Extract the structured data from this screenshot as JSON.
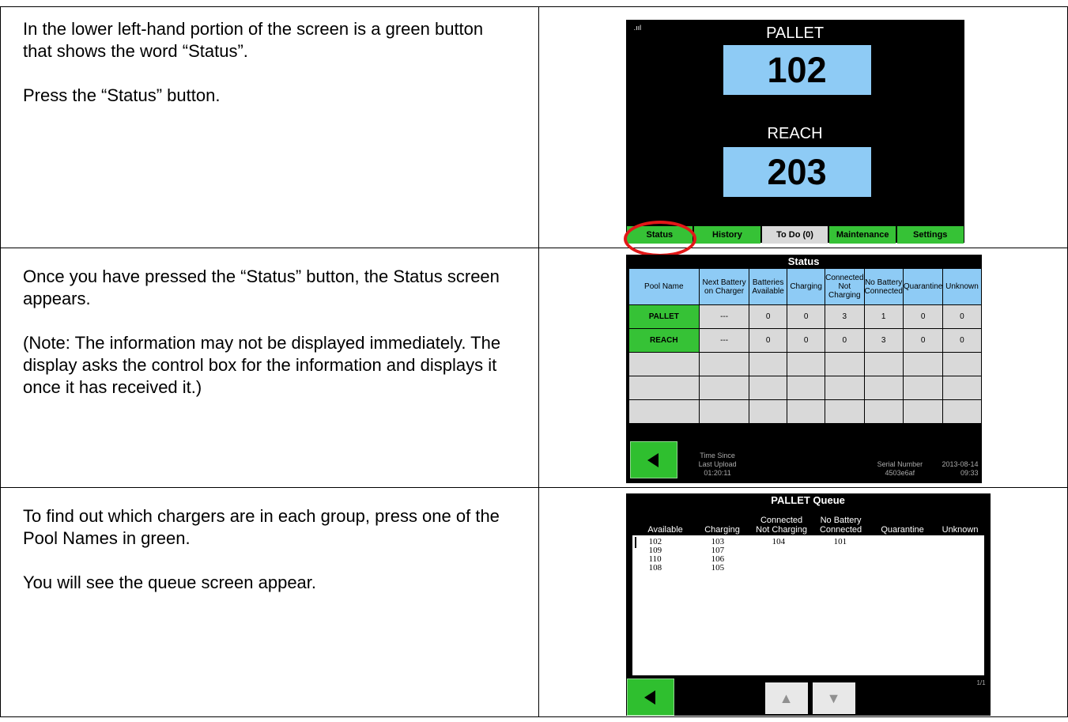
{
  "rows": [
    {
      "paragraphs": [
        "In the lower left-hand portion of the screen is a green button that shows the word “Status”.",
        "Press the “Status” button."
      ]
    },
    {
      "paragraphs": [
        "Once you have pressed the “Status” button, the Status screen appears.",
        "(Note: The information may not be displayed immediately. The display asks the control box for the information and displays it once it has received it.)"
      ]
    },
    {
      "paragraphs": [
        "To find out which chargers are in each group, press one of the Pool Names in green.",
        "You will see the queue screen appear."
      ]
    }
  ],
  "screen1": {
    "signal": ".ııl",
    "pool1_label": "PALLET",
    "pool1_value": "102",
    "pool2_label": "REACH",
    "pool2_value": "203",
    "tabs": [
      "Status",
      "History",
      "To Do (0)",
      "Maintenance",
      "Settings"
    ]
  },
  "screen2": {
    "title": "Status",
    "headers": [
      "Pool Name",
      "Next Battery on Charger",
      "Batteries Available",
      "Charging",
      "Connected Not Charging",
      "No Battery Connected",
      "Quarantine",
      "Unknown"
    ],
    "rows": [
      {
        "pool": "PALLET",
        "next": "---",
        "available": "0",
        "charging": "0",
        "connected_not_charging": "3",
        "no_battery": "1",
        "quarantine": "0",
        "unknown": "0"
      },
      {
        "pool": "REACH",
        "next": "---",
        "available": "0",
        "charging": "0",
        "connected_not_charging": "0",
        "no_battery": "3",
        "quarantine": "0",
        "unknown": "0"
      }
    ],
    "time_since_label_1": "Time Since",
    "time_since_label_2": "Last Upload",
    "time_since_value": "01:20:11",
    "serial_label": "Serial Number",
    "serial_value": "4503e6af",
    "date": "2013-08-14",
    "time": "09:33"
  },
  "screen3": {
    "title": "PALLET Queue",
    "columns": [
      {
        "h1": "",
        "h2": "Available",
        "values": [
          "102",
          "109",
          "110",
          "108"
        ]
      },
      {
        "h1": "",
        "h2": "Charging",
        "values": [
          "103",
          "107",
          "106",
          "105"
        ]
      },
      {
        "h1": "Connected",
        "h2": "Not Charging",
        "values": [
          "104"
        ]
      },
      {
        "h1": "No Battery",
        "h2": "Connected",
        "values": [
          "101"
        ]
      },
      {
        "h1": "",
        "h2": "Quarantine",
        "values": []
      },
      {
        "h1": "",
        "h2": "Unknown",
        "values": []
      }
    ],
    "page_indicator": "1/1"
  }
}
